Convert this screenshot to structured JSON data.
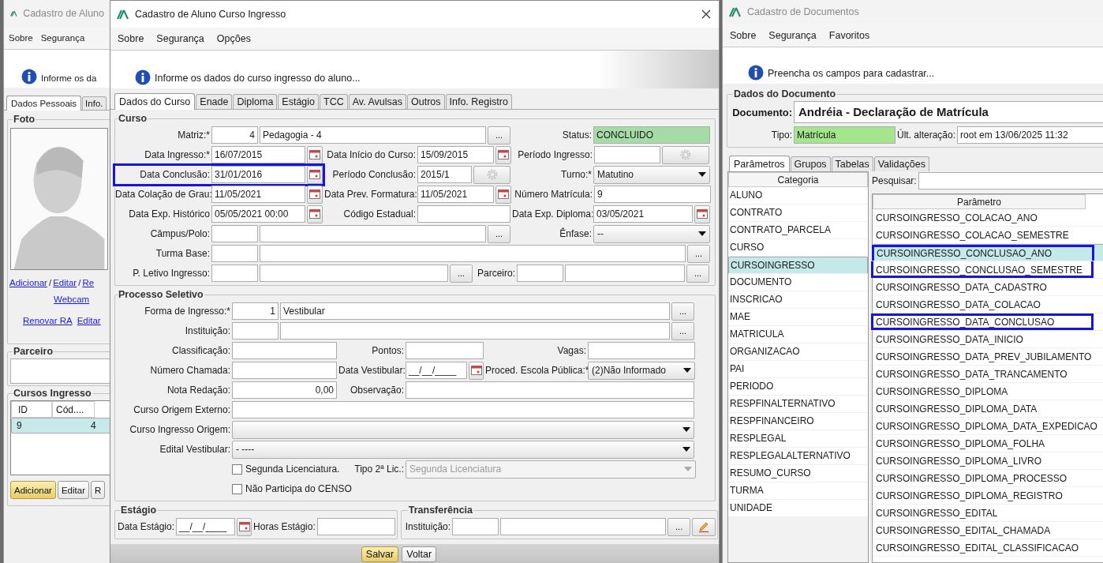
{
  "left_window": {
    "title": "Cadastro de Aluno",
    "menu": [
      "Sobre",
      "Segurança"
    ],
    "info": "Informe os da",
    "tabs": [
      {
        "label": "Dados Pessoais",
        "selected": true
      },
      {
        "label": "Info.",
        "selected": false
      }
    ],
    "foto_title": "Foto",
    "photo_links": [
      {
        "kind": "link",
        "text": "Adicionar"
      },
      {
        "kind": "sep",
        "text": "/"
      },
      {
        "kind": "link",
        "text": "Editar"
      },
      {
        "kind": "sep",
        "text": "/"
      },
      {
        "kind": "link",
        "text": "Re"
      }
    ],
    "webcam": "Webcam",
    "links": [
      "Renovar RA",
      "Editar"
    ],
    "parceiro_title": "Parceiro",
    "cursos_title": "Cursos Ingresso",
    "columns": [
      "ID",
      "Cód...."
    ],
    "rows": [
      {
        "cells": [
          "9",
          "4"
        ],
        "selected": true
      }
    ],
    "buttons": [
      {
        "label": "Adicionar",
        "kind": "primary"
      },
      {
        "label": "Editar",
        "kind": "normal"
      },
      {
        "label": "R",
        "kind": "normal"
      }
    ]
  },
  "dialog": {
    "title": "Cadastro de Aluno Curso Ingresso",
    "menu": [
      "Sobre",
      "Segurança",
      "Opções"
    ],
    "info": "Informe os dados do curso ingresso do aluno...",
    "tabs": [
      {
        "label": "Dados do Curso",
        "selected": true
      },
      {
        "label": "Enade",
        "selected": false
      },
      {
        "label": "Diploma",
        "selected": false
      },
      {
        "label": "Estágio",
        "selected": false
      },
      {
        "label": "TCC",
        "selected": false
      },
      {
        "label": "Av. Avulsas",
        "selected": false
      },
      {
        "label": "Outros",
        "selected": false
      },
      {
        "label": "Info. Registro",
        "selected": false
      }
    ],
    "curso": {
      "title": "Curso",
      "matriz": {
        "label": "Matriz:*",
        "code": "4",
        "value": "Pedagogia - 4",
        "button": "..."
      },
      "status": {
        "label": "Status:",
        "value": "CONCLUIDO"
      },
      "data_ingresso": {
        "label": "Data Ingresso:*",
        "value": "16/07/2015"
      },
      "data_inicio": {
        "label": "Data Início do Curso:",
        "value": "15/09/2015"
      },
      "periodo_ingresso": {
        "label": "Período Ingresso:"
      },
      "data_conclusao": {
        "label": "Data Conclusão:",
        "value": "31/01/2016",
        "outlined": true
      },
      "periodo_conclusao": {
        "label": "Período Conclusão:",
        "value": "2015/1"
      },
      "turno": {
        "label": "Turno:*",
        "value": "Matutino"
      },
      "data_colacao": {
        "label": "Data Colação de Grau:",
        "value": "11/05/2021"
      },
      "data_prev": {
        "label": "Data Prev. Formatura:",
        "value": "11/05/2021"
      },
      "numero_matricula": {
        "label": "Número Matrícula:",
        "value": "9"
      },
      "data_historico": {
        "label": "Data Exp. Histórico",
        "value": "05/05/2021 00:00"
      },
      "codigo_estadual": {
        "label": "Código Estadual:"
      },
      "data_diploma": {
        "label": "Data Exp. Diploma:",
        "value": "03/05/2021"
      },
      "campus": {
        "label": "Câmpus/Polo:",
        "button": "..."
      },
      "enfase": {
        "label": "Ênfase:",
        "value": "--"
      },
      "turma_base": {
        "label": "Turma Base:",
        "button": "..."
      },
      "periodo_letivo": {
        "label": "P. Letivo Ingresso:",
        "button": "..."
      },
      "parceiro": {
        "label": "Parceiro:",
        "button": "..."
      }
    },
    "processo": {
      "title": "Processo Seletivo",
      "forma": {
        "label": "Forma de Ingresso:*",
        "code": "1",
        "value": "Vestibular",
        "button": "..."
      },
      "instituicao": {
        "label": "Instituição:",
        "button": "..."
      },
      "classificacao": {
        "label": "Classificação:"
      },
      "pontos": {
        "label": "Pontos:"
      },
      "vagas": {
        "label": "Vagas:"
      },
      "numero_chamada": {
        "label": "Número Chamada:"
      },
      "data_vestibular": {
        "label": "Data Vestibular:",
        "value": "__/__/____"
      },
      "escola_publica": {
        "label": "Proced. Escola Pública:*",
        "value": "(2)Não Informado"
      },
      "nota_redacao": {
        "label": "Nota Redação:",
        "value": "0,00"
      },
      "observacao": {
        "label": "Observação:"
      },
      "curso_origem_externo": {
        "label": "Curso Origem Externo:"
      },
      "curso_ingresso_origem": {
        "label": "Curso Ingresso Origem:"
      },
      "edital": {
        "label": "Edital Vestibular:",
        "value": "- ----"
      },
      "segunda_licenciatura": {
        "label": "Segunda Licenciatura.",
        "checked": false
      },
      "tipo_lic": {
        "label": "Tipo 2ª Lic.:",
        "value": "Segunda Licenciatura",
        "disabled": true
      },
      "censo": {
        "label": "Não Participa do CENSO",
        "checked": false
      }
    },
    "estagio": {
      "title": "Estágio",
      "data": {
        "label": "Data Estágio:",
        "value": "__/__/____"
      },
      "horas": {
        "label": "Horas Estágio:"
      }
    },
    "transferencia": {
      "title": "Transferência",
      "instituicao": {
        "label": "Instituição:",
        "button": "..."
      }
    },
    "buttons": [
      {
        "label": "Salvar",
        "kind": "primary"
      },
      {
        "label": "Voltar",
        "kind": "normal"
      }
    ]
  },
  "doc_window": {
    "title": "Cadastro de Documentos",
    "menu": [
      "Sobre",
      "Segurança",
      "Favoritos"
    ],
    "info": "Preencha os campos para cadastrar...",
    "section": "Dados do Documento",
    "documento": {
      "label": "Documento:",
      "value": "Andréia - Declaração de Matrícula"
    },
    "tipo": {
      "label": "Tipo:",
      "value": "Matrícula"
    },
    "ultima": {
      "label": "Últ. alteração:",
      "value": "root em 13/06/2025 11:32"
    },
    "tabs": [
      {
        "label": "Parâmetros",
        "selected": true
      },
      {
        "label": "Grupos",
        "selected": false
      },
      {
        "label": "Tabelas",
        "selected": false
      },
      {
        "label": "Validações",
        "selected": false
      }
    ],
    "categoria_header": "Categoria",
    "categorias": [
      {
        "label": "ALUNO",
        "selected": false
      },
      {
        "label": "CONTRATO",
        "selected": false
      },
      {
        "label": "CONTRATO_PARCELA",
        "selected": false
      },
      {
        "label": "CURSO",
        "selected": false
      },
      {
        "label": "CURSOINGRESSO",
        "selected": true
      },
      {
        "label": "DOCUMENTO",
        "selected": false
      },
      {
        "label": "INSCRICAO",
        "selected": false
      },
      {
        "label": "MAE",
        "selected": false
      },
      {
        "label": "MATRICULA",
        "selected": false
      },
      {
        "label": "ORGANIZACAO",
        "selected": false
      },
      {
        "label": "PAI",
        "selected": false
      },
      {
        "label": "PERIODO",
        "selected": false
      },
      {
        "label": "RESPFINALTERNATIVO",
        "selected": false
      },
      {
        "label": "RESPFINANCEIRO",
        "selected": false
      },
      {
        "label": "RESPLEGAL",
        "selected": false
      },
      {
        "label": "RESPLEGALALTERNATIVO",
        "selected": false
      },
      {
        "label": "RESUMO_CURSO",
        "selected": false
      },
      {
        "label": "TURMA",
        "selected": false
      },
      {
        "label": "UNIDADE",
        "selected": false
      }
    ],
    "search_label": "Pesquisar:",
    "parametro_header": "Parâmetro",
    "parametros": [
      {
        "label": "CURSOINGRESSO_COLACAO_ANO",
        "selected": false,
        "outlined": false
      },
      {
        "label": "CURSOINGRESSO_COLACAO_SEMESTRE",
        "selected": false,
        "outlined": false
      },
      {
        "label": "CURSOINGRESSO_CONCLUSAO_ANO",
        "selected": true,
        "outlined": true
      },
      {
        "label": "CURSOINGRESSO_CONCLUSAO_SEMESTRE",
        "selected": false,
        "outlined": true
      },
      {
        "label": "CURSOINGRESSO_DATA_CADASTRO",
        "selected": false,
        "outlined": false
      },
      {
        "label": "CURSOINGRESSO_DATA_COLACAO",
        "selected": false,
        "outlined": false
      },
      {
        "label": "CURSOINGRESSO_DATA_CONCLUSAO",
        "selected": false,
        "outlined": true
      },
      {
        "label": "CURSOINGRESSO_DATA_INICIO",
        "selected": false,
        "outlined": false
      },
      {
        "label": "CURSOINGRESSO_DATA_PREV_JUBILAMENTO",
        "selected": false,
        "outlined": false
      },
      {
        "label": "CURSOINGRESSO_DATA_TRANCAMENTO",
        "selected": false,
        "outlined": false
      },
      {
        "label": "CURSOINGRESSO_DIPLOMA",
        "selected": false,
        "outlined": false
      },
      {
        "label": "CURSOINGRESSO_DIPLOMA_DATA",
        "selected": false,
        "outlined": false
      },
      {
        "label": "CURSOINGRESSO_DIPLOMA_DATA_EXPEDICAO",
        "selected": false,
        "outlined": false
      },
      {
        "label": "CURSOINGRESSO_DIPLOMA_FOLHA",
        "selected": false,
        "outlined": false
      },
      {
        "label": "CURSOINGRESSO_DIPLOMA_LIVRO",
        "selected": false,
        "outlined": false
      },
      {
        "label": "CURSOINGRESSO_DIPLOMA_PROCESSO",
        "selected": false,
        "outlined": false
      },
      {
        "label": "CURSOINGRESSO_DIPLOMA_REGISTRO",
        "selected": false,
        "outlined": false
      },
      {
        "label": "CURSOINGRESSO_EDITAL",
        "selected": false,
        "outlined": false
      },
      {
        "label": "CURSOINGRESSO_EDITAL_CHAMADA",
        "selected": false,
        "outlined": false
      },
      {
        "label": "CURSOINGRESSO_EDITAL_CLASSIFICACAO",
        "selected": false,
        "outlined": false
      }
    ]
  }
}
